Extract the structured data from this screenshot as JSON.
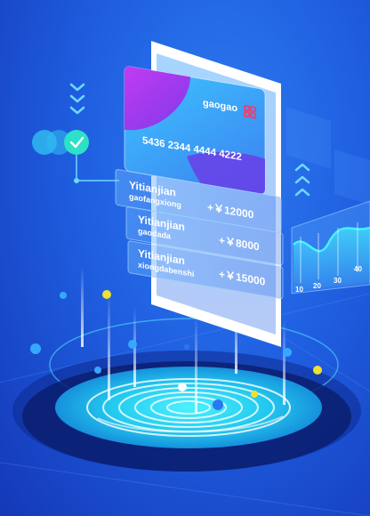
{
  "card": {
    "brand": "gaogao",
    "number": "5436 2344 4444 4222"
  },
  "transactions": [
    {
      "title": "Yitianjian",
      "subtitle": "gaofangxiong",
      "amount": "+￥12000"
    },
    {
      "title": "Yitianjian",
      "subtitle": "gaodada",
      "amount": "+￥8000"
    },
    {
      "title": "Yitianjian",
      "subtitle": "xiongdabenshi",
      "amount": "+￥15000"
    }
  ],
  "mini_chart": {
    "tick_labels": [
      "10",
      "20",
      "30",
      "40"
    ]
  },
  "colors": {
    "background": "#1f5fe0",
    "card_start": "#34b6ff",
    "card_end": "#4a6cf0",
    "accent_purple": "#b43cf0",
    "accent_cyan": "#46f0ff",
    "brand_logo": "#e0467a",
    "dot_yellow": "#f0e030"
  },
  "icons": [
    "chevron-down-icon",
    "chevron-up-icon",
    "checkmark-icon",
    "fingerprint-icon",
    "card-logo-icon"
  ]
}
